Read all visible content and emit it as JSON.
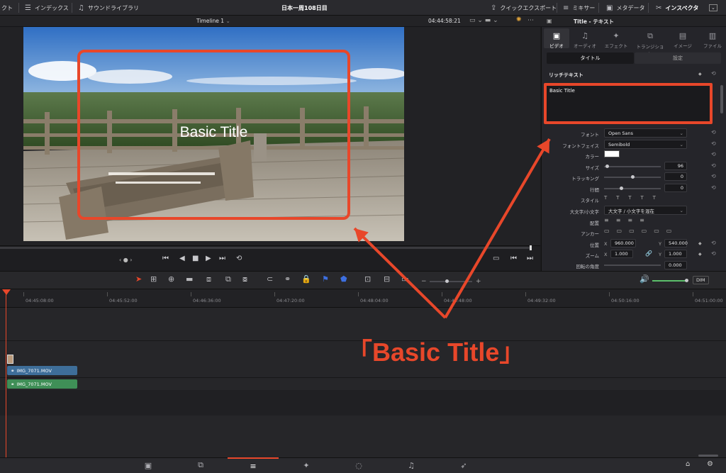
{
  "topbar": {
    "left_cut": "クト",
    "index": "インデックス",
    "sound_library": "サウンドライブラリ",
    "project_title": "日本一周108日目",
    "quick_export": "クイックエクスポート",
    "mixer": "ミキサー",
    "metadata": "メタデータ",
    "inspector": "インスペクタ"
  },
  "viewer": {
    "timeline_name": "Timeline 1",
    "timecode": "04:44:58:21",
    "title_overlay": "Basic Title",
    "playback_indicator": "‹ ● ›"
  },
  "timeline": {
    "ruler_labels": [
      "04:45:08:00",
      "04:45:52:00",
      "04:46:36:00",
      "04:47:20:00",
      "04:48:04:00",
      "04:48:48:00",
      "04:49:32:00",
      "04:50:16:00",
      "04:51:00:00"
    ],
    "video_clip": "IMG_7071.MOV",
    "audio_clip": "IMG_7071.MOV",
    "dim_label": "DIM"
  },
  "inspector": {
    "header_title": "Title - テキスト",
    "tabs": [
      {
        "label": "ビデオ",
        "icon": "video-icon"
      },
      {
        "label": "オーディオ",
        "icon": "audio-icon"
      },
      {
        "label": "エフェクト",
        "icon": "effect-icon"
      },
      {
        "label": "トランジション",
        "icon": "transition-icon"
      },
      {
        "label": "イメージ",
        "icon": "image-icon"
      },
      {
        "label": "ファイル",
        "icon": "file-icon"
      }
    ],
    "subtab_title": "タイトル",
    "subtab_settings": "設定",
    "section_rich_text": "リッチテキスト",
    "rich_text_value": "Basic Title",
    "font_label": "フォント",
    "font_value": "Open Sans",
    "face_label": "フォントフェイス",
    "face_value": "Semibold",
    "color_label": "カラー",
    "color_value": "#ffffff",
    "size_label": "サイズ",
    "size_value": "96",
    "size_fraction": 0.05,
    "tracking_label": "トラッキング",
    "tracking_value": "0",
    "tracking_fraction": 0.5,
    "leading_label": "行間",
    "leading_value": "0",
    "leading_fraction": 0.3,
    "style_label": "スタイル",
    "case_label": "大文字/小文字",
    "case_value": "大文字 / 小文字を混在",
    "align_label": "配置",
    "anchor_label": "アンカー",
    "position_label": "位置",
    "position_x": "960.000",
    "position_y": "540.000",
    "zoom_label": "ズーム",
    "zoom_x": "1.000",
    "zoom_y": "1.000",
    "rotation_label": "回転の角度",
    "rotation_value": "0.000",
    "axis_x": "X",
    "axis_y": "Y"
  },
  "annotation": {
    "callout": "「Basic Title」",
    "color": "#e8472a"
  }
}
